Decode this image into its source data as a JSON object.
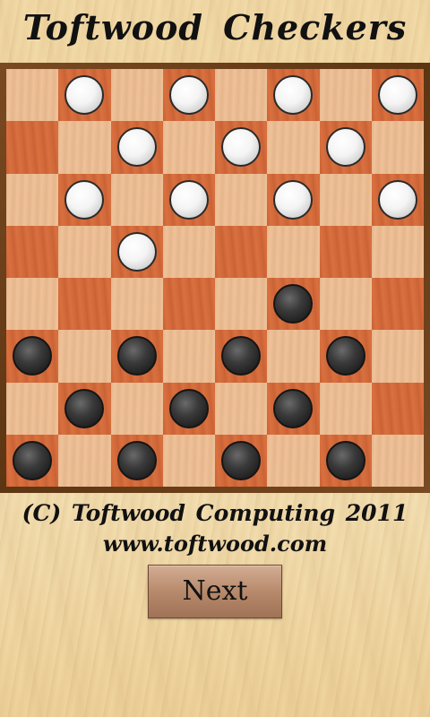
{
  "header": {
    "title": "Toftwood Checkers"
  },
  "board": {
    "size": 8,
    "light_color": "#efc29a",
    "dark_color": "#d9703f",
    "frame_color": "#6b3f1a",
    "rows": [
      [
        null,
        "white",
        null,
        "white",
        null,
        "white",
        null,
        "white"
      ],
      [
        null,
        null,
        "white",
        null,
        "white",
        null,
        "white",
        null
      ],
      [
        null,
        "white",
        null,
        "white",
        null,
        "white",
        null,
        "white"
      ],
      [
        null,
        null,
        "white",
        null,
        null,
        null,
        null,
        null
      ],
      [
        null,
        null,
        null,
        null,
        null,
        "black",
        null,
        null
      ],
      [
        "black",
        null,
        "black",
        null,
        "black",
        null,
        "black",
        null
      ],
      [
        null,
        "black",
        null,
        "black",
        null,
        "black",
        null,
        null
      ],
      [
        "black",
        null,
        "black",
        null,
        "black",
        null,
        "black",
        null
      ]
    ]
  },
  "footer": {
    "copyright": "(C) Toftwood Computing 2011",
    "website": "www.toftwood.com",
    "next_label": "Next"
  }
}
